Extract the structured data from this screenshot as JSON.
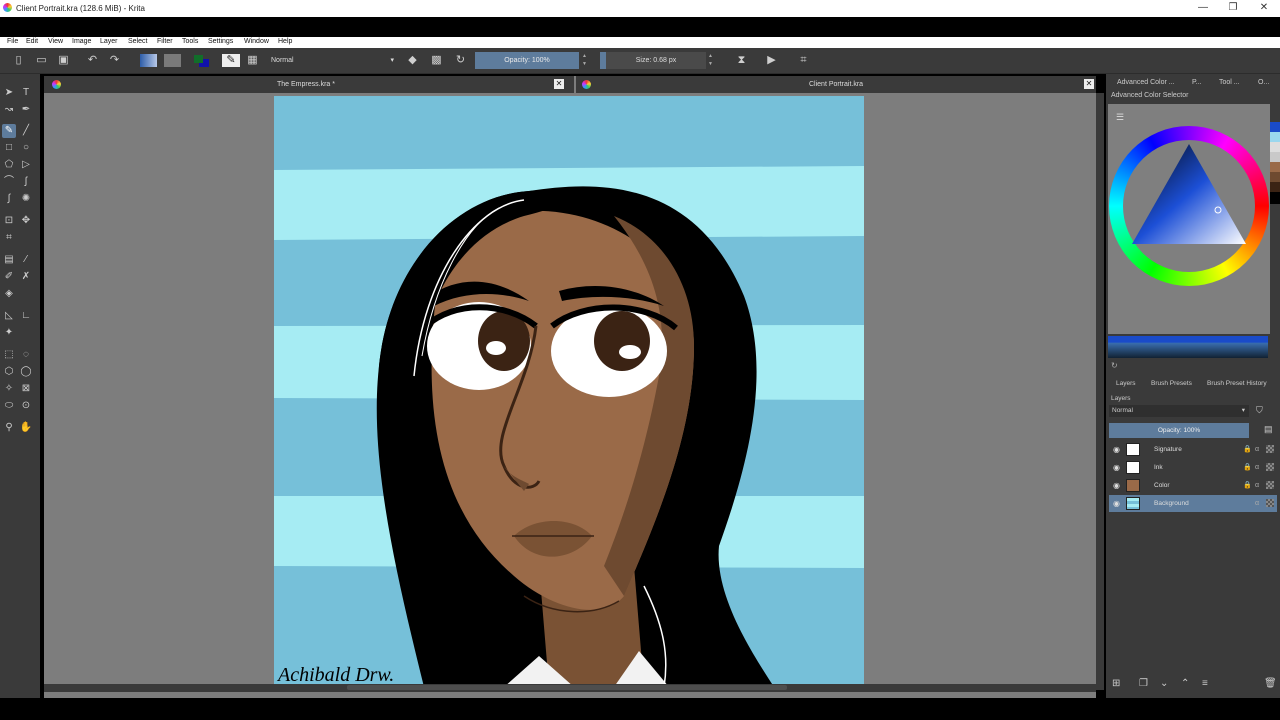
{
  "window": {
    "title": "Client Portrait.kra (128.6 MiB)  - Krita",
    "controls": [
      "—",
      "❐",
      "✕"
    ]
  },
  "menu": [
    "File",
    "Edit",
    "View",
    "Image",
    "Layer",
    "Select",
    "Filter",
    "Tools",
    "Settings",
    "Window",
    "Help"
  ],
  "toolbar": {
    "blend_mode": "Normal",
    "opacity": "Opacity: 100%",
    "size": "Size: 0.68 px"
  },
  "documents": [
    {
      "title": "The Empress.kra *"
    },
    {
      "title": "Client Portrait.kra"
    }
  ],
  "artwork": {
    "signature": "Achibald Drw.",
    "bg_light": "#a6ecf3",
    "bg_dark": "#76c0d9",
    "skin": "#9a6a48",
    "skin_shadow": "#6e4a30",
    "hair": "#000000"
  },
  "right_panel": {
    "tabs": [
      "Advanced Color ...",
      "P...",
      "Tool ...",
      "O..."
    ],
    "color_selector_title": "Advanced Color Selector",
    "layer_tabs": [
      "Layers",
      "Brush Presets",
      "Brush Preset History"
    ],
    "layers_label": "Layers",
    "layer_blend": "Normal",
    "layer_opacity": "Opacity:  100%",
    "layers": [
      {
        "name": "Signature",
        "selected": false,
        "locked": true
      },
      {
        "name": "Ink",
        "selected": false,
        "locked": true
      },
      {
        "name": "Color",
        "selected": false,
        "locked": true
      },
      {
        "name": "Background",
        "selected": true,
        "locked": false
      }
    ]
  },
  "colors": {
    "accent": "#5e7c9c",
    "panel": "#3a3a3a",
    "canvas_bg": "#7d7d7d"
  }
}
